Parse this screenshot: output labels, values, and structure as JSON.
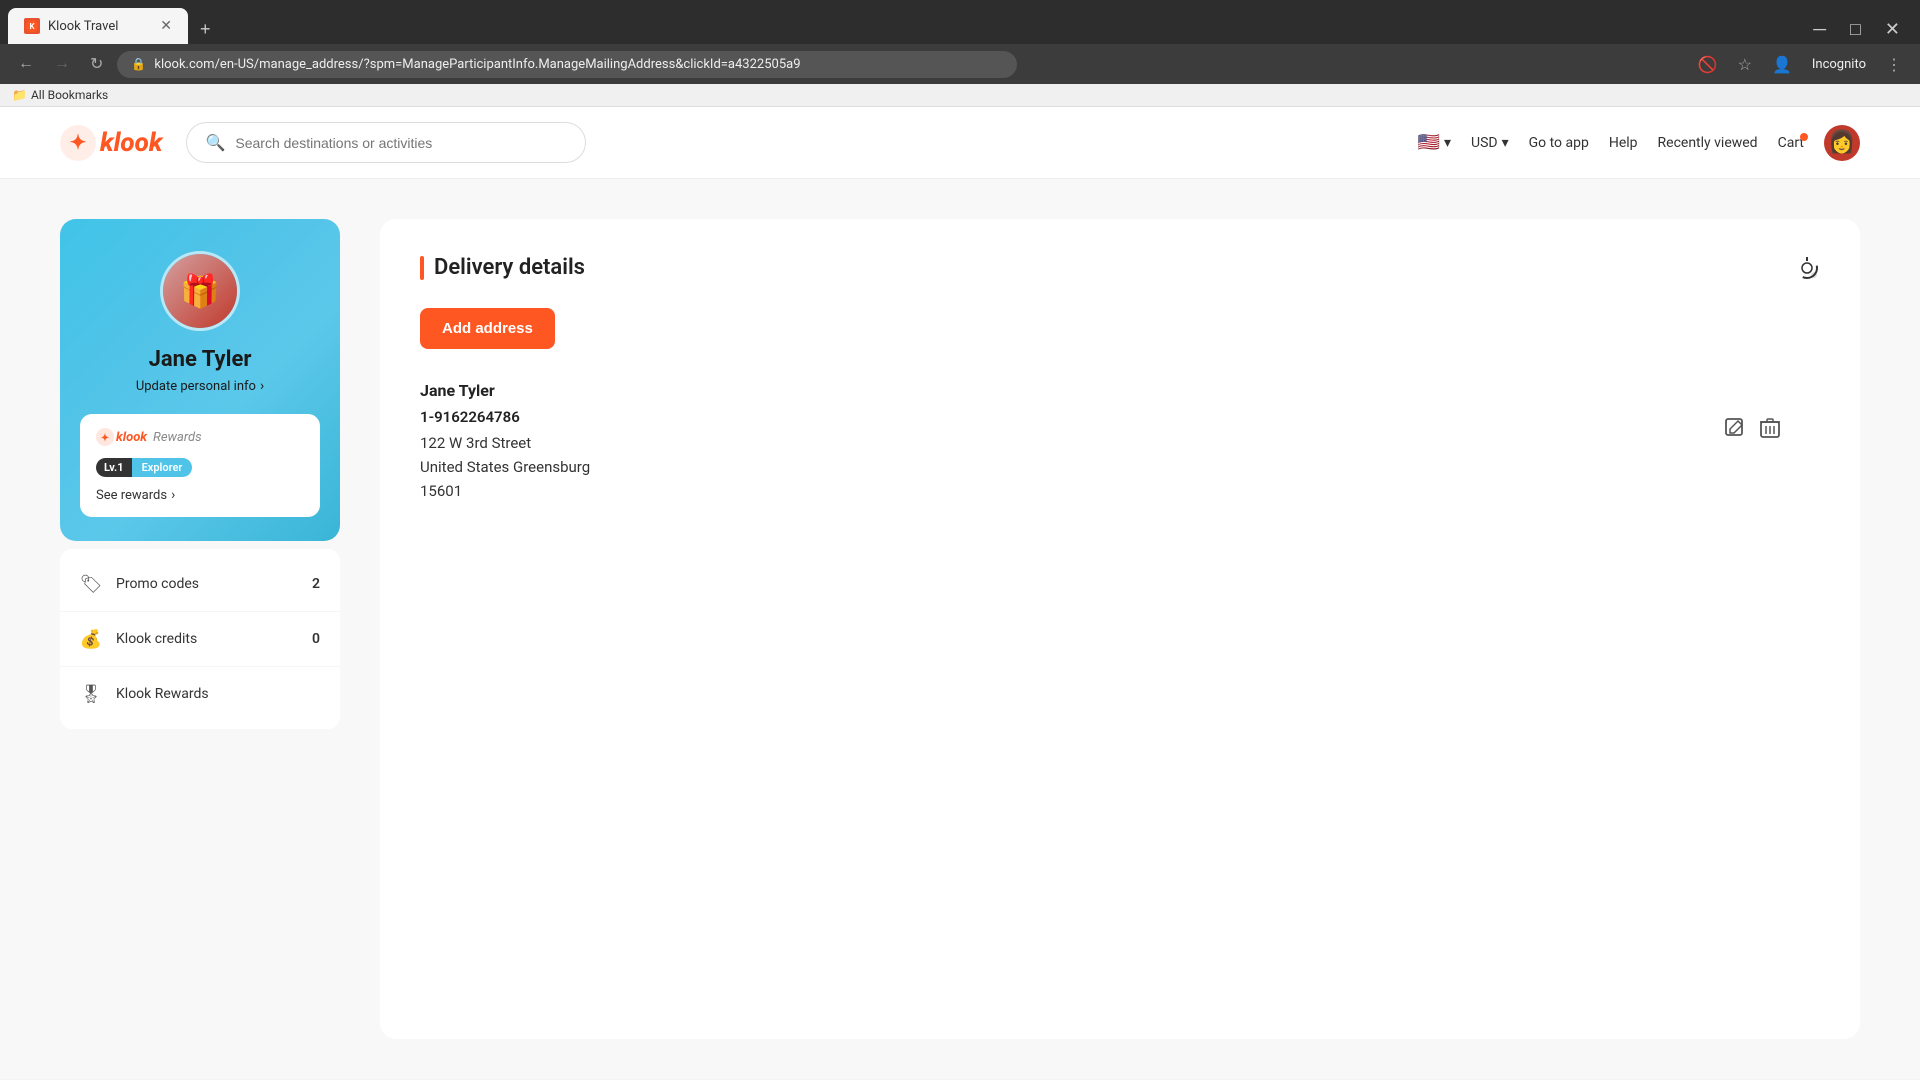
{
  "browser": {
    "tab_title": "Klook Travel",
    "url": "klook.com/en-US/manage_address/?spm=ManageParticipantInfo.ManageMailingAddress&clickId=a4322505a9",
    "bookmarks_folder": "All Bookmarks",
    "new_tab_label": "+",
    "back_disabled": false,
    "forward_disabled": true
  },
  "header": {
    "logo_text": "klook",
    "search_placeholder": "Search destinations or activities",
    "flag_emoji": "🇺🇸",
    "currency": "USD",
    "go_to_app": "Go to app",
    "help": "Help",
    "recently_viewed": "Recently viewed",
    "cart": "Cart"
  },
  "sidebar": {
    "user_name": "Jane Tyler",
    "update_link": "Update personal info",
    "rewards_label": "klook",
    "rewards_sub": "Rewards",
    "level_num": "Lv.1",
    "level_name": "Explorer",
    "see_rewards": "See rewards",
    "menu_items": [
      {
        "label": "Promo codes",
        "icon": "🏷",
        "count": "2"
      },
      {
        "label": "Klook credits",
        "icon": "💰",
        "count": "0"
      },
      {
        "label": "Klook Rewards",
        "icon": "🎖",
        "count": ""
      }
    ]
  },
  "main": {
    "section_title": "Delivery details",
    "add_address_btn": "Add address",
    "address": {
      "name": "Jane Tyler",
      "phone": "1-9162264786",
      "street": "122 W 3rd Street",
      "city_state": "United States Greensburg",
      "zip": "15601"
    }
  }
}
